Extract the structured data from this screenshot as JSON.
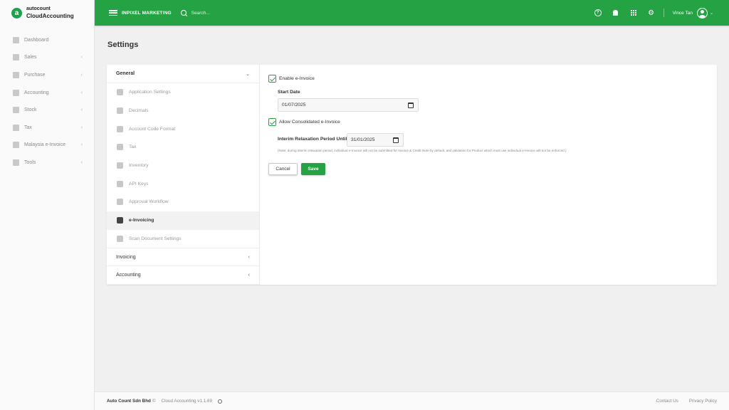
{
  "brand": {
    "top": "autocount",
    "bottom": "CloudAccounting",
    "logo_letter": "a"
  },
  "sidebar": {
    "items": [
      {
        "label": "Dashboard",
        "icon": "dashboard-icon",
        "has_caret": false
      },
      {
        "label": "Sales",
        "icon": "sales-icon",
        "has_caret": true
      },
      {
        "label": "Purchase",
        "icon": "purchase-icon",
        "has_caret": true
      },
      {
        "label": "Accounting",
        "icon": "accounting-icon",
        "has_caret": true
      },
      {
        "label": "Stock",
        "icon": "stock-icon",
        "has_caret": true
      },
      {
        "label": "Tax",
        "icon": "tax-icon",
        "has_caret": true
      },
      {
        "label": "Malaysia e-Invoice",
        "icon": "einvoice-icon",
        "has_caret": true
      },
      {
        "label": "Tools",
        "icon": "wrench-icon",
        "has_caret": true
      }
    ],
    "caret": "‹"
  },
  "header": {
    "company": "INPIXEL MARKETING",
    "search_placeholder": "Search...",
    "user_name": "Vince Tan",
    "help_glyph": "?",
    "gear_glyph": "⚙",
    "caret_glyph": "⌄"
  },
  "page": {
    "title": "Settings"
  },
  "settings_nav": {
    "general_label": "General",
    "general_chevron": "⌄",
    "sub_items": [
      {
        "label": "Application Settings",
        "active": false
      },
      {
        "label": "Decimals",
        "active": false
      },
      {
        "label": "Account Code Format",
        "active": false
      },
      {
        "label": "Tax",
        "active": false
      },
      {
        "label": "Inventory",
        "active": false
      },
      {
        "label": "API Keys",
        "active": false
      },
      {
        "label": "Approval Workflow",
        "active": false
      },
      {
        "label": "e-Invoicing",
        "active": true
      },
      {
        "label": "Scan Document Settings",
        "active": false
      }
    ],
    "invoicing_label": "Invoicing",
    "accounting_label": "Accounting",
    "collapsed_chevron": "‹"
  },
  "einvoice": {
    "enable_label": "Enable e-Invoice",
    "enable_checked": true,
    "start_date_label": "Start Date",
    "start_date_value": "01/07/2025",
    "consolidated_label": "Allow Consolidated e-Invoice",
    "consolidated_checked": true,
    "interim_label": "Interim Relaxation Period Until",
    "interim_value": "31/01/2025",
    "note": "(Note: during interim relaxation period, individual e-Invoice will not be submitted for Invoice & Credit Note by default, and validation for Product which must use individual e-Invoice will not be enforced.)",
    "cancel_label": "Cancel",
    "save_label": "Save"
  },
  "footer": {
    "company": "Auto Count Sdn Bhd",
    "copyright": "©",
    "version": "Cloud Accounting v1.1.69",
    "contact": "Contact Us",
    "privacy": "Privacy Policy"
  },
  "colors": {
    "brand_green": "#25a244"
  }
}
